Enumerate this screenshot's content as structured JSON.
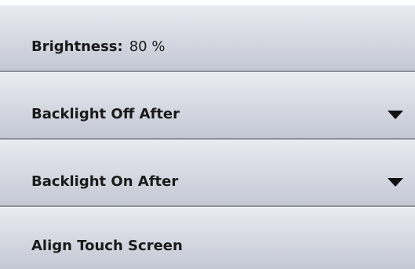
{
  "settings": {
    "items": [
      {
        "label": "Brightness:",
        "value": "80 %"
      },
      {
        "label": "Backlight Off After",
        "icon": "dropdown-arrow-icon"
      },
      {
        "label": "Backlight On After",
        "icon": "dropdown-arrow-icon"
      },
      {
        "label": "Align Touch Screen"
      }
    ]
  },
  "colors": {
    "row_top": "#e9ebf1",
    "row_bottom": "#c4c8d3",
    "separator": "#8c909b",
    "text": "#1a1a1a"
  }
}
